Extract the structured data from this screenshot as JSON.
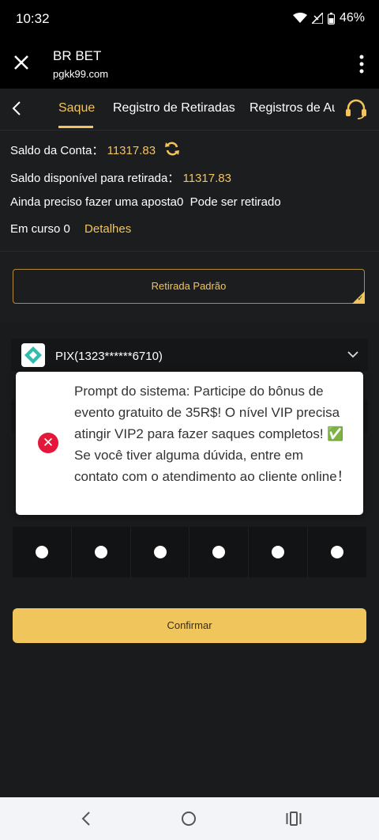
{
  "status_bar": {
    "time": "10:32",
    "battery": "46%"
  },
  "browser": {
    "title": "BR BET",
    "url": "pgkk99.com"
  },
  "tabs": [
    {
      "label": "Saque"
    },
    {
      "label": "Registro de Retiradas"
    },
    {
      "label": "Registros de Au"
    }
  ],
  "account": {
    "saldo_label": "Saldo da Conta：",
    "saldo_value": "11317.83",
    "disponivel_label": "Saldo disponível para retirada：",
    "disponivel_value": "11317.83",
    "aposta_text": "Ainda preciso fazer uma aposta0  Pode ser retirado",
    "em_curso_text": "Em curso 0",
    "detalhes_link": "Detalhes"
  },
  "withdrawal_type": {
    "label": "Retirada Padrão"
  },
  "pix": {
    "account": "PIX(1323******6710)"
  },
  "pin": {
    "cells": 6
  },
  "confirm": {
    "label": "Confirmar"
  },
  "popup": {
    "message": "Prompt do sistema: Participe do bônus de evento gratuito de 35R$! O nível VIP precisa atingir VIP2 para fazer saques completos! ✅ Se você tiver alguma dúvida, entre em contato com o atendimento ao cliente online！"
  },
  "colors": {
    "accent": "#f3c45d",
    "background": "#1c1d1f",
    "error": "#e4163a"
  },
  "icons": [
    "close-icon",
    "more-vert-icon",
    "chevron-left-icon",
    "headset-icon",
    "refresh-icon",
    "pix-icon",
    "chevron-down-icon",
    "error-icon",
    "nav-back-icon",
    "nav-home-icon",
    "nav-recent-icon"
  ]
}
